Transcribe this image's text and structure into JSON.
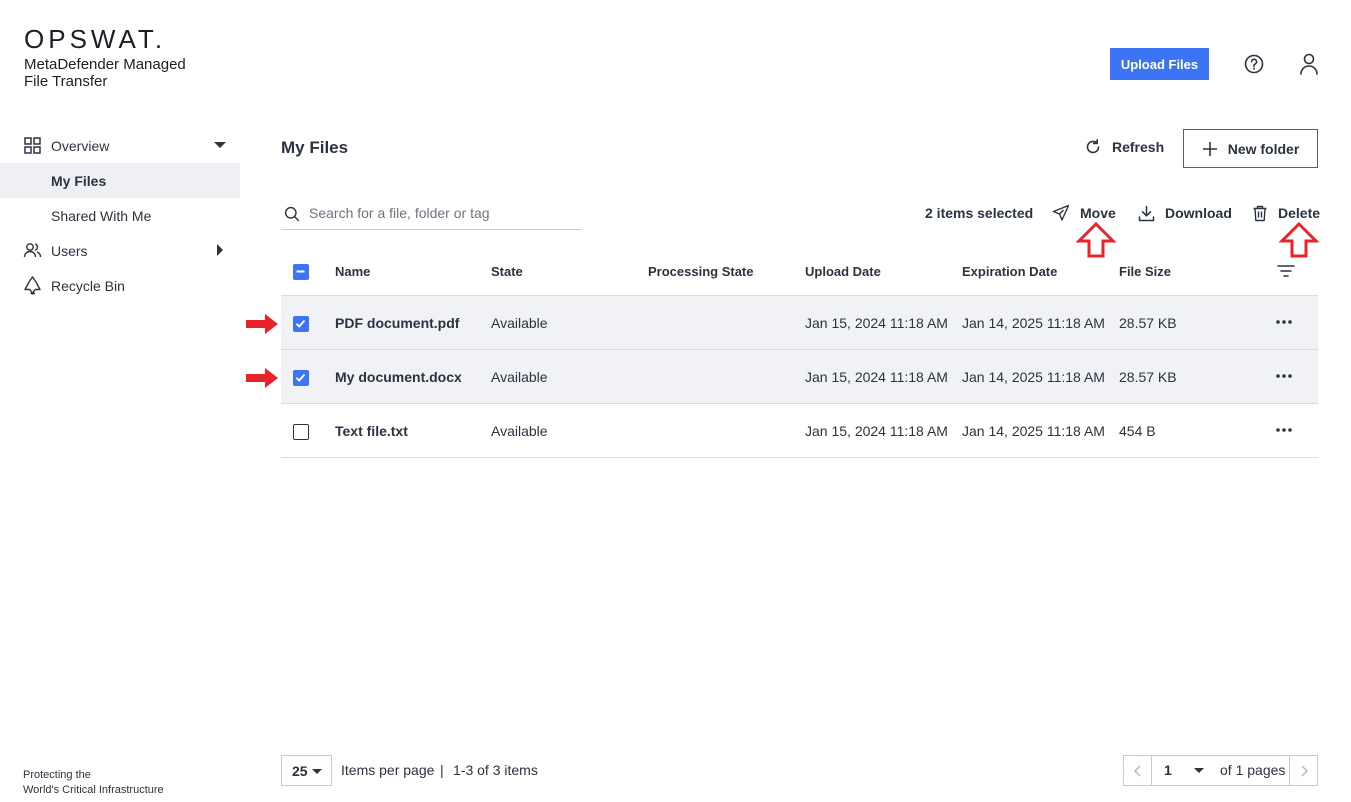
{
  "brand": {
    "logo_text": "OPSWAT.",
    "product_line1": "MetaDefender Managed",
    "product_line2": "File Transfer"
  },
  "header": {
    "upload_label": "Upload Files",
    "help_icon": "help-circle-icon",
    "user_icon": "user-icon"
  },
  "sidebar": {
    "items": [
      {
        "label": "Overview",
        "icon": "grid-icon",
        "expander": "caret-down"
      },
      {
        "label": "My Files",
        "active": true
      },
      {
        "label": "Shared With Me"
      },
      {
        "label": "Users",
        "icon": "users-icon",
        "expander": "caret-right"
      },
      {
        "label": "Recycle Bin",
        "icon": "recycle-icon"
      }
    ],
    "footer_line1": "Protecting the",
    "footer_line2": "World's Critical Infrastructure"
  },
  "main": {
    "title": "My Files",
    "refresh_label": "Refresh",
    "new_folder_label": "New folder",
    "search_placeholder": "Search for a file, folder or tag",
    "selection_count": "2 items selected",
    "actions": {
      "move": "Move",
      "download": "Download",
      "delete": "Delete"
    }
  },
  "table": {
    "columns": [
      "Name",
      "State",
      "Processing State",
      "Upload Date",
      "Expiration Date",
      "File Size"
    ],
    "rows": [
      {
        "name": "PDF document.pdf",
        "state": "Available",
        "processing": "",
        "uploaded": "Jan 15, 2024 11:18 AM",
        "expires": "Jan 14, 2025 11:18 AM",
        "size": "28.57 KB",
        "checked": true
      },
      {
        "name": "My document.docx",
        "state": "Available",
        "processing": "",
        "uploaded": "Jan 15, 2024 11:18 AM",
        "expires": "Jan 14, 2025 11:18 AM",
        "size": "28.57 KB",
        "checked": true
      },
      {
        "name": "Text file.txt",
        "state": "Available",
        "processing": "",
        "uploaded": "Jan 15, 2024 11:18 AM",
        "expires": "Jan 14, 2025 11:18 AM",
        "size": "454 B",
        "checked": false
      }
    ]
  },
  "pagination": {
    "per_page": "25",
    "per_page_label": "Items per page",
    "separator": "|",
    "range": "1-3 of 3 items",
    "page": "1",
    "of_pages": "of 1 pages"
  },
  "colors": {
    "accent": "#3d74f5",
    "annotation": "#e8242a",
    "selected_row": "#f1f2f5"
  }
}
